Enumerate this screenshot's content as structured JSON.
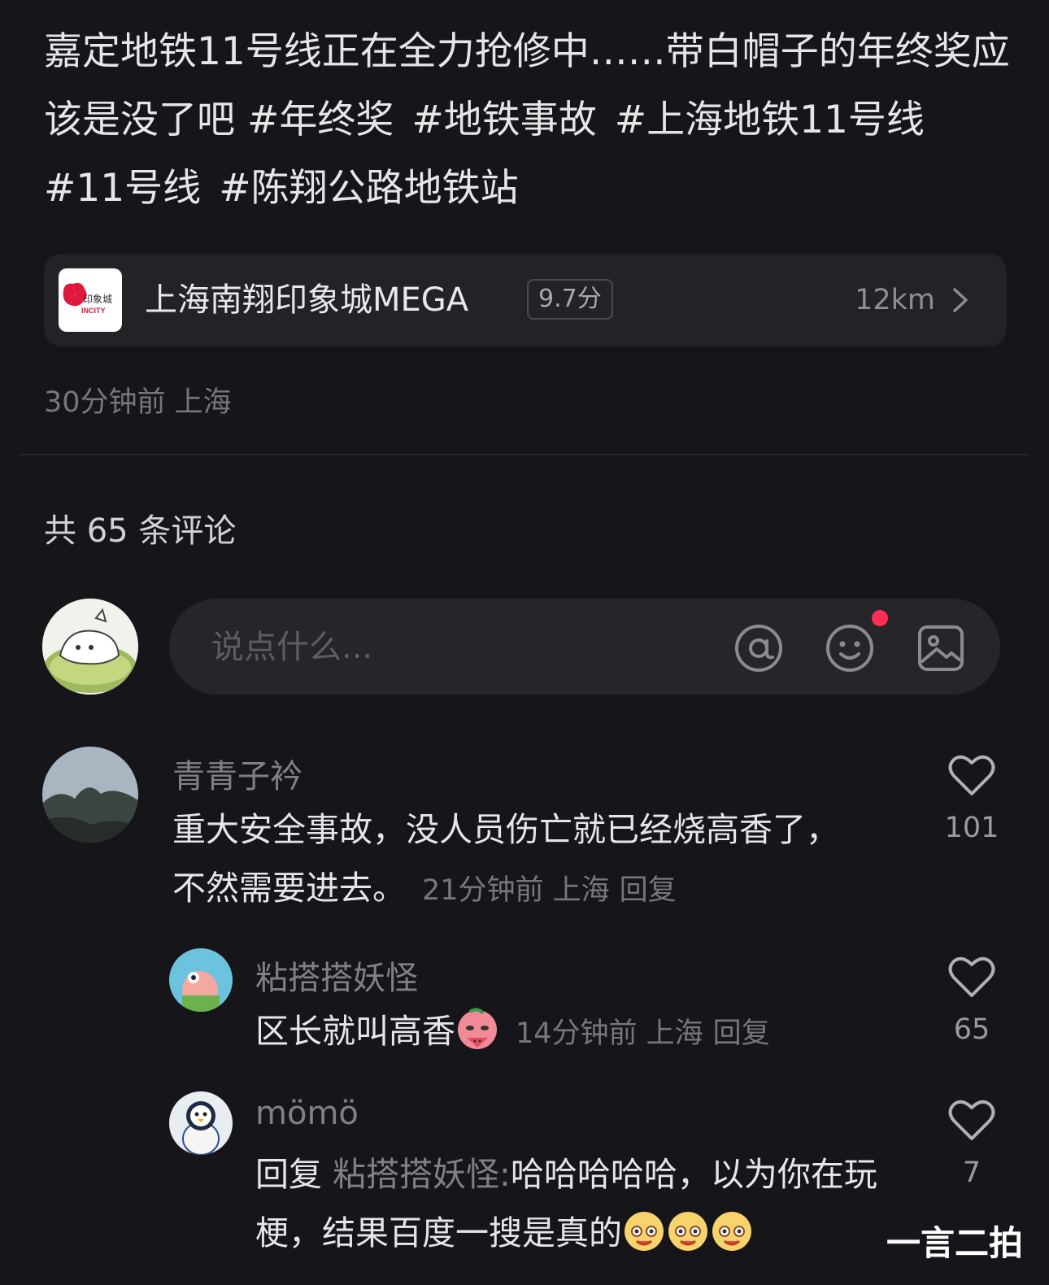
{
  "post": {
    "text": "嘉定地铁11号线正在全力抢修中……带白帽子的年终奖应该是没了吧",
    "hashtags": [
      "#年终奖",
      "#地铁事故",
      "#上海地铁11号线",
      "#11号线",
      "#陈翔公路地铁站"
    ],
    "location": {
      "logo_text": "印象城",
      "logo_sub": "INCITY",
      "name": "上海南翔印象城MEGA",
      "rating": "9.7分",
      "distance": "12km"
    },
    "meta": "30分钟前 上海"
  },
  "comments_header": "共 65 条评论",
  "comment_input": {
    "placeholder": "说点什么..."
  },
  "comments": [
    {
      "name": "青青子衿",
      "text": "重大安全事故，没人员伤亡就已经烧高香了，不然需要进去。",
      "time": "21分钟前 上海",
      "reply_label": "回复",
      "likes": "101"
    },
    {
      "name": "粘搭搭妖怪",
      "text": "区长就叫高香",
      "time": "14分钟前 上海",
      "reply_label": "回复",
      "likes": "65"
    },
    {
      "name": "mömö",
      "reply_prefix": "回复",
      "reply_to": "粘搭搭妖怪:",
      "text": "哈哈哈哈哈，以为你在玩梗，结果百度一搜是真的",
      "likes": "7"
    }
  ],
  "watermark": "一言二拍",
  "colors": {
    "background": "#16161a",
    "card": "#222227",
    "notify": "#ff2d55",
    "brand_red": "#e0163b"
  }
}
